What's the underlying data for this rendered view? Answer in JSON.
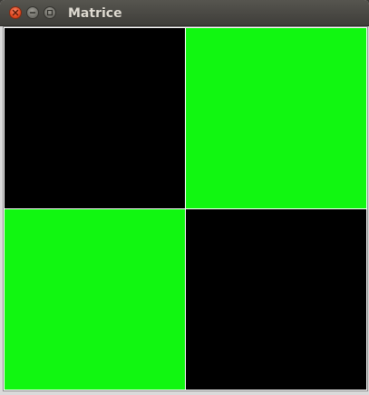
{
  "window": {
    "title": "Matrice"
  },
  "matrix": {
    "rows": 2,
    "cols": 2,
    "cells": [
      [
        0,
        1
      ],
      [
        1,
        0
      ]
    ],
    "colors": {
      "0": "#000000",
      "1": "#11f711"
    }
  }
}
